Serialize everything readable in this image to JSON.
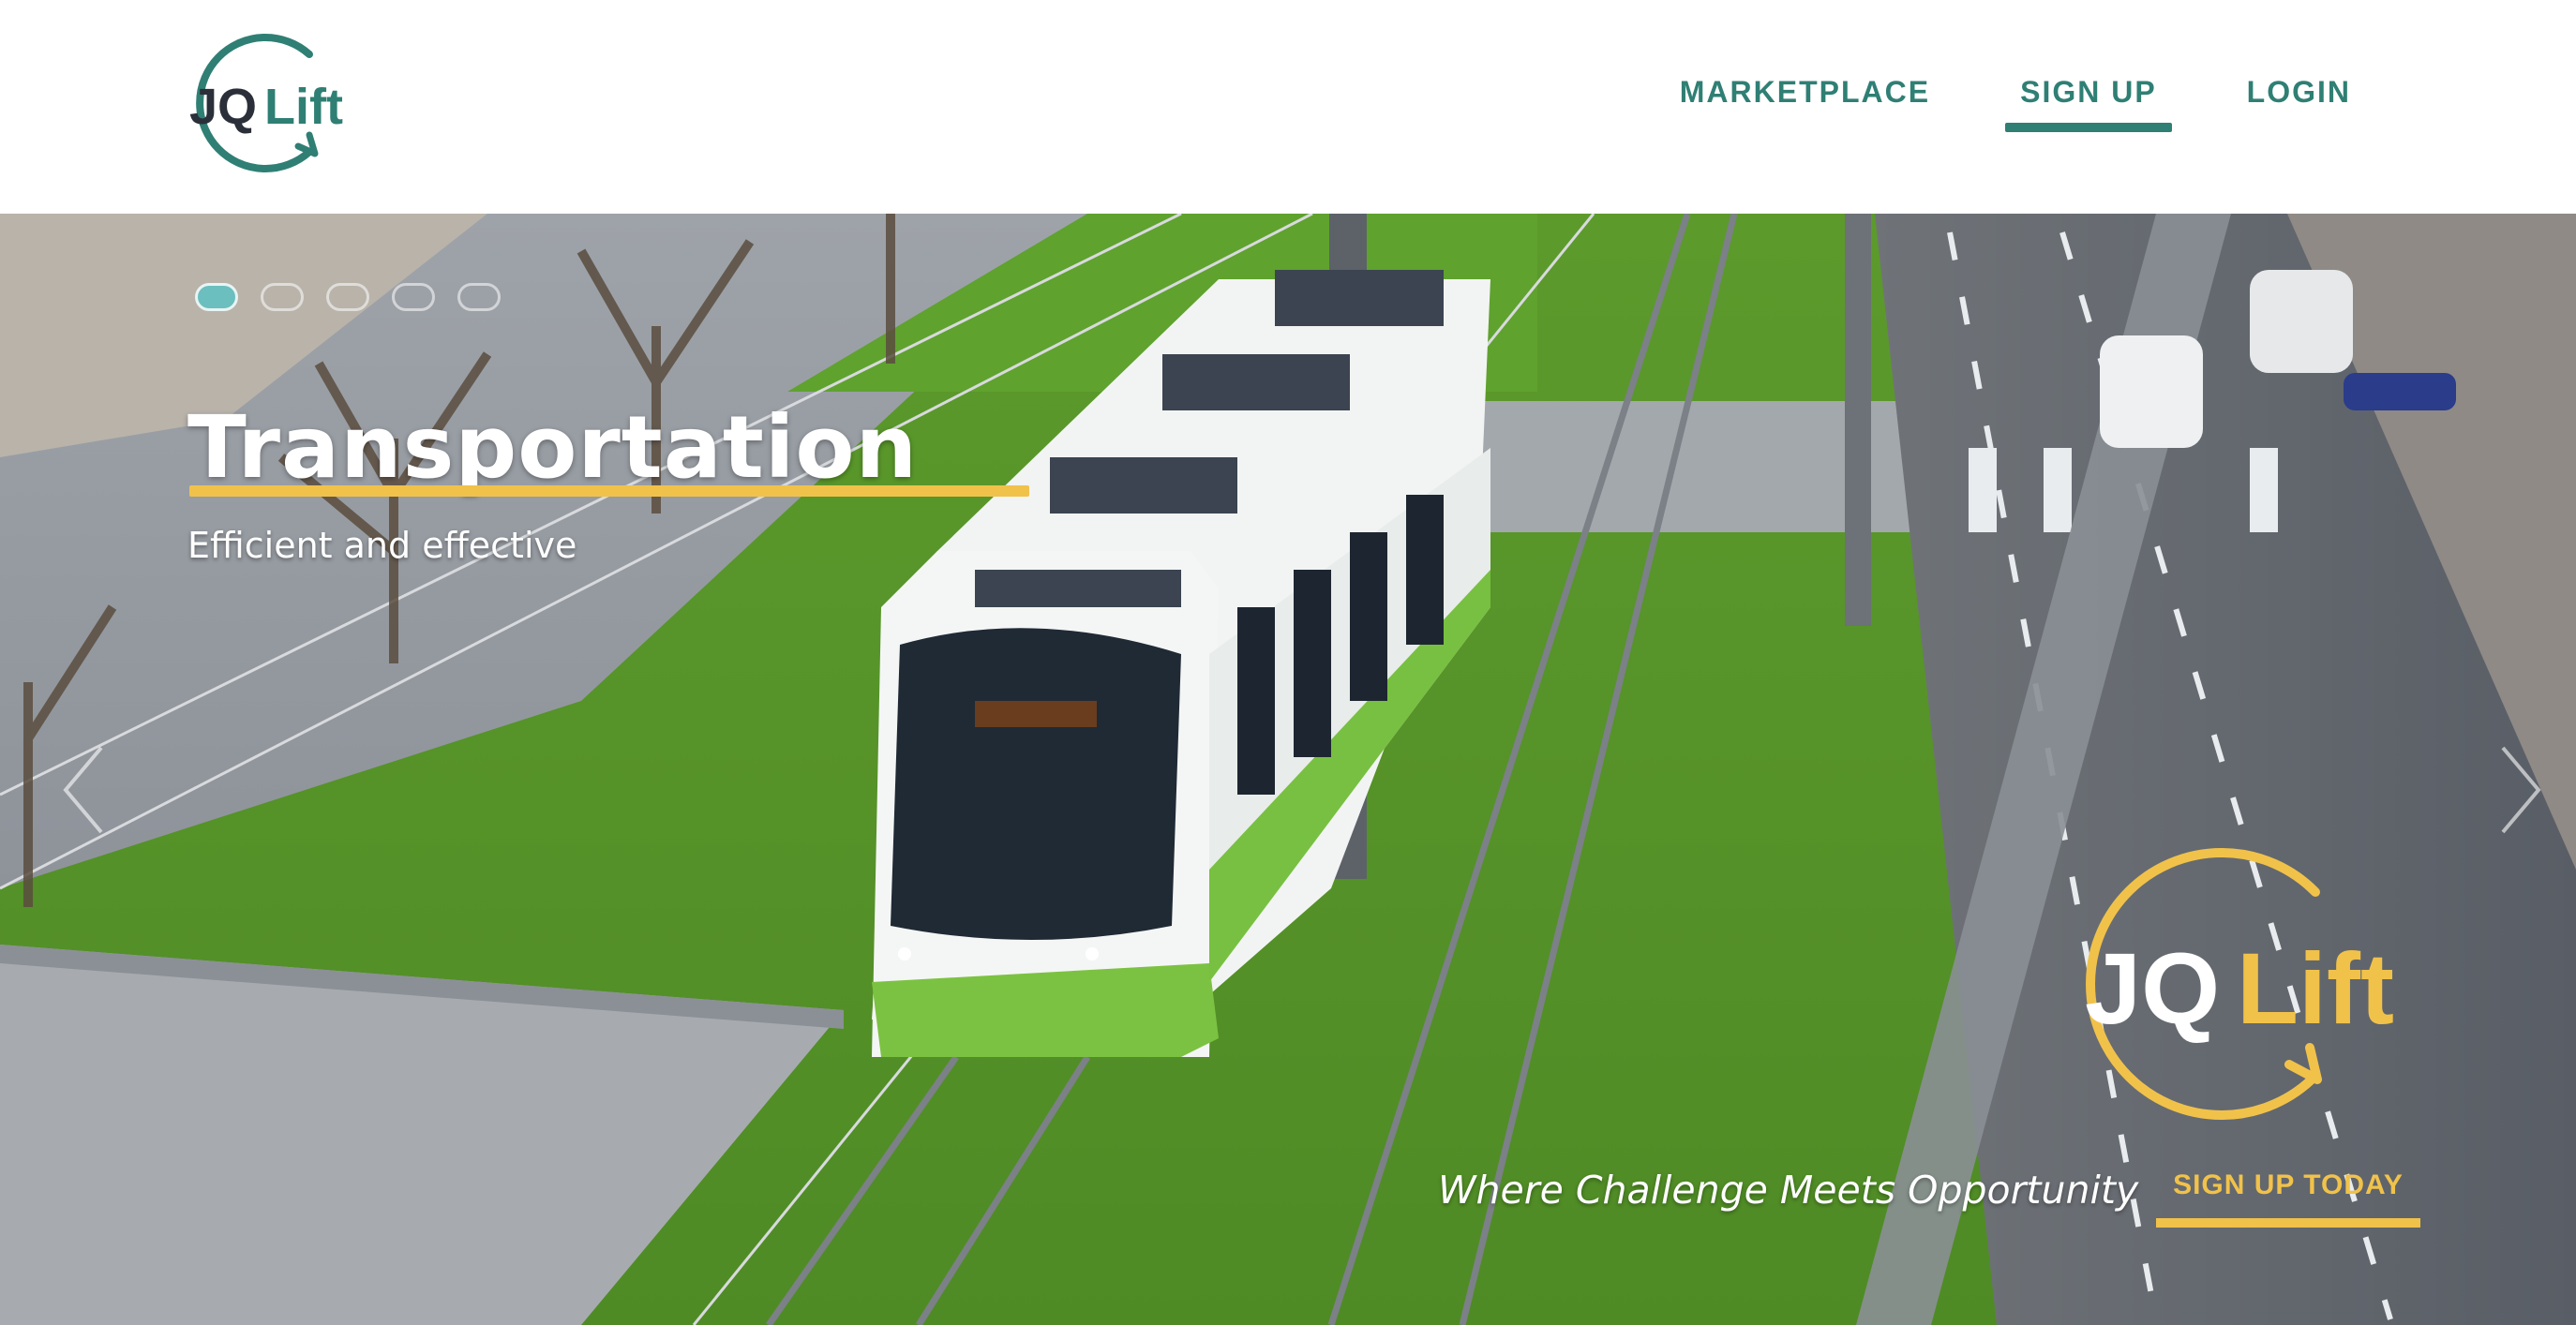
{
  "header": {
    "logo": {
      "text_jq": "JQ",
      "text_lift": "Lift",
      "color_dark": "#2b2f3a",
      "color_teal": "#2f7f74"
    },
    "nav": [
      {
        "label": "MARKETPLACE",
        "active": false
      },
      {
        "label": "SIGN UP",
        "active": true
      },
      {
        "label": "LOGIN",
        "active": false
      }
    ],
    "accent_color": "#2f7f74"
  },
  "hero": {
    "slide_count": 5,
    "active_slide": 1,
    "title": "Transportation",
    "subtitle": "Efficient and effective",
    "title_accent_color": "#f1c24a",
    "prev_icon": "chevron-left-icon",
    "next_icon": "chevron-right-icon",
    "logo": {
      "text_jq": "JQ",
      "text_lift": "Lift",
      "color": "#f1c24a"
    },
    "tagline": "Where Challenge Meets Opportunity",
    "cta_label": "SIGN UP TODAY"
  }
}
